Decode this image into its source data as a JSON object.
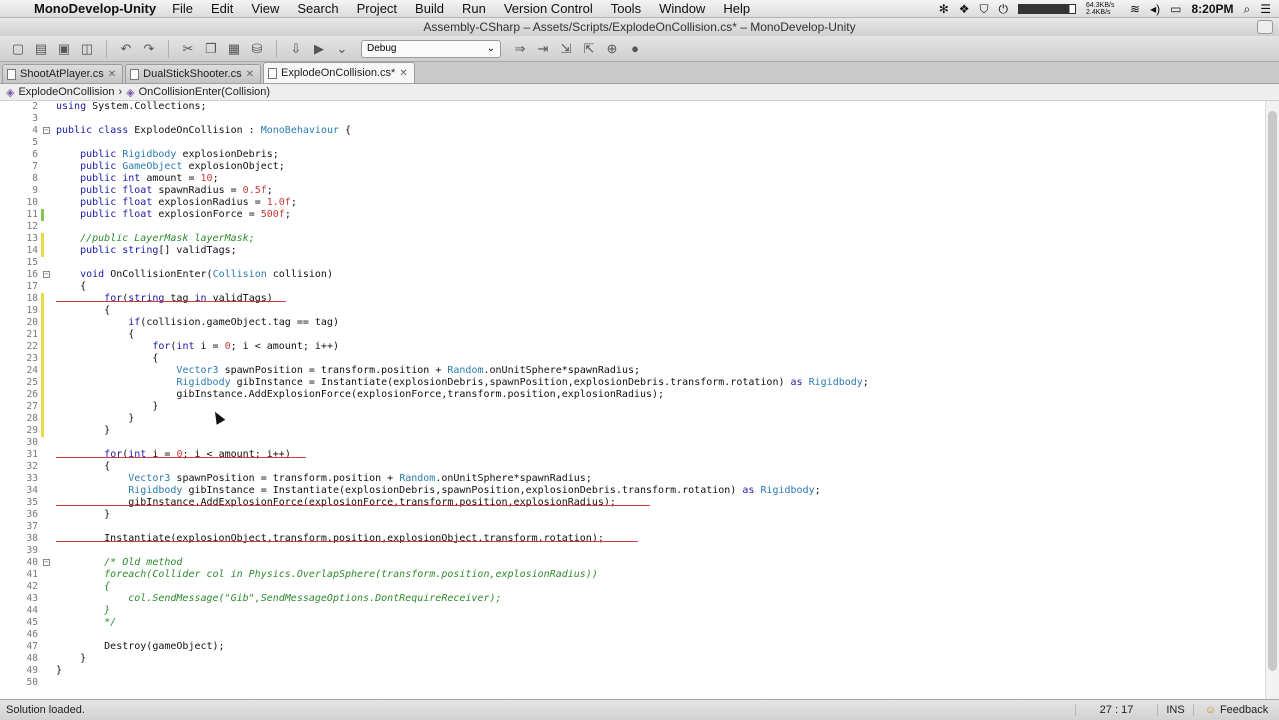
{
  "menubar": {
    "app_name": "MonoDevelop-Unity",
    "items": [
      "File",
      "Edit",
      "View",
      "Search",
      "Project",
      "Build",
      "Run",
      "Version Control",
      "Tools",
      "Window",
      "Help"
    ],
    "clock": "8:20PM",
    "network": "64.3KB/s 2.4KB/s"
  },
  "titlebar": {
    "title": "Assembly-CSharp – Assets/Scripts/ExplodeOnCollision.cs* – MonoDevelop-Unity"
  },
  "toolbar": {
    "config_value": "Debug"
  },
  "tabs": [
    {
      "label": "ShootAtPlayer.cs",
      "active": false
    },
    {
      "label": "DualStickShooter.cs",
      "active": false
    },
    {
      "label": "ExplodeOnCollision.cs*",
      "active": true
    }
  ],
  "breadcrumb": {
    "class_name": "ExplodeOnCollision",
    "method_name": "OnCollisionEnter(Collision)"
  },
  "code_lines": [
    {
      "n": "2",
      "text": "using System.Collections;",
      "mark": ""
    },
    {
      "n": "3",
      "text": "",
      "mark": ""
    },
    {
      "n": "4",
      "text": "public class ExplodeOnCollision : MonoBehaviour {",
      "mark": "",
      "fold": true
    },
    {
      "n": "5",
      "text": "",
      "mark": ""
    },
    {
      "n": "6",
      "text": "    public Rigidbody explosionDebris;",
      "mark": ""
    },
    {
      "n": "7",
      "text": "    public GameObject explosionObject;",
      "mark": ""
    },
    {
      "n": "8",
      "text": "    public int amount = 10;",
      "mark": ""
    },
    {
      "n": "9",
      "text": "    public float spawnRadius = 0.5f;",
      "mark": ""
    },
    {
      "n": "10",
      "text": "    public float explosionRadius = 1.0f;",
      "mark": ""
    },
    {
      "n": "11",
      "text": "    public float explosionForce = 500f;",
      "mark": "green"
    },
    {
      "n": "12",
      "text": "",
      "mark": ""
    },
    {
      "n": "13",
      "text": "    //public LayerMask layerMask;",
      "mark": "yellow"
    },
    {
      "n": "14",
      "text": "    public string[] validTags;",
      "mark": "yellow"
    },
    {
      "n": "15",
      "text": "",
      "mark": ""
    },
    {
      "n": "16",
      "text": "    void OnCollisionEnter(Collision collision)",
      "mark": "",
      "fold": true
    },
    {
      "n": "17",
      "text": "    {",
      "mark": ""
    },
    {
      "n": "18",
      "text": "        for(string tag in validTags)",
      "mark": "yellow"
    },
    {
      "n": "19",
      "text": "        {",
      "mark": "yellow"
    },
    {
      "n": "20",
      "text": "            if(collision.gameObject.tag == tag)",
      "mark": "yellow"
    },
    {
      "n": "21",
      "text": "            {",
      "mark": "yellow"
    },
    {
      "n": "22",
      "text": "                for(int i = 0; i < amount; i++)",
      "mark": "yellow"
    },
    {
      "n": "23",
      "text": "                {",
      "mark": "yellow"
    },
    {
      "n": "24",
      "text": "                    Vector3 spawnPosition = transform.position + Random.onUnitSphere*spawnRadius;",
      "mark": "yellow"
    },
    {
      "n": "25",
      "text": "                    Rigidbody gibInstance = Instantiate(explosionDebris,spawnPosition,explosionDebris.transform.rotation) as Rigidbody;",
      "mark": "yellow"
    },
    {
      "n": "26",
      "text": "                    gibInstance.AddExplosionForce(explosionForce,transform.position,explosionRadius);",
      "mark": "yellow"
    },
    {
      "n": "27",
      "text": "                }",
      "mark": "yellow"
    },
    {
      "n": "28",
      "text": "            }",
      "mark": "yellow"
    },
    {
      "n": "29",
      "text": "        }",
      "mark": "yellow"
    },
    {
      "n": "30",
      "text": "",
      "mark": ""
    },
    {
      "n": "31",
      "text": "        for(int i = 0; i < amount; i++)",
      "mark": ""
    },
    {
      "n": "32",
      "text": "        {",
      "mark": ""
    },
    {
      "n": "33",
      "text": "            Vector3 spawnPosition = transform.position + Random.onUnitSphere*spawnRadius;",
      "mark": ""
    },
    {
      "n": "34",
      "text": "            Rigidbody gibInstance = Instantiate(explosionDebris,spawnPosition,explosionDebris.transform.rotation) as Rigidbody;",
      "mark": ""
    },
    {
      "n": "35",
      "text": "            gibInstance.AddExplosionForce(explosionForce,transform.position,explosionRadius);",
      "mark": ""
    },
    {
      "n": "36",
      "text": "        }",
      "mark": ""
    },
    {
      "n": "37",
      "text": "",
      "mark": ""
    },
    {
      "n": "38",
      "text": "        Instantiate(explosionObject,transform.position,explosionObject.transform.rotation);",
      "mark": ""
    },
    {
      "n": "39",
      "text": "",
      "mark": ""
    },
    {
      "n": "40",
      "text": "        /* Old method",
      "mark": "",
      "fold": true
    },
    {
      "n": "41",
      "text": "        foreach(Collider col in Physics.OverlapSphere(transform.position,explosionRadius))",
      "mark": ""
    },
    {
      "n": "42",
      "text": "        {",
      "mark": ""
    },
    {
      "n": "43",
      "text": "            col.SendMessage(\"Gib\",SendMessageOptions.DontRequireReceiver);",
      "mark": ""
    },
    {
      "n": "44",
      "text": "        }",
      "mark": ""
    },
    {
      "n": "45",
      "text": "        */",
      "mark": ""
    },
    {
      "n": "46",
      "text": "",
      "mark": ""
    },
    {
      "n": "47",
      "text": "        Destroy(gameObject);",
      "mark": ""
    },
    {
      "n": "48",
      "text": "    }",
      "mark": ""
    },
    {
      "n": "49",
      "text": "}",
      "mark": ""
    },
    {
      "n": "50",
      "text": "",
      "mark": ""
    }
  ],
  "statusbar": {
    "message": "Solution loaded.",
    "position": "27 : 17",
    "mode": "INS",
    "feedback": "Feedback"
  },
  "colors": {
    "keyword": "#1a1aa6",
    "type": "#2a7ab0",
    "comment": "#2e8b2e",
    "number": "#c23a3a",
    "underline": "#d03a3a",
    "mark_green": "#7ec850",
    "mark_yellow": "#e6d84a"
  }
}
